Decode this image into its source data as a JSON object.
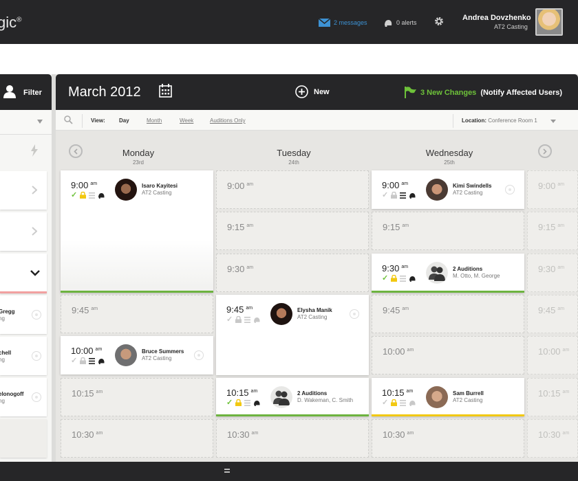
{
  "topbar": {
    "logo_text": "gic",
    "logo_mark": "®",
    "messages_label": "2 messages",
    "alerts_label": "0 alerts",
    "user_name": "Andrea Dovzhenko",
    "user_company": "AT2 Casting",
    "icons": [
      "mail-icon",
      "bell-icon",
      "gear-icon"
    ]
  },
  "left_panel": {
    "filter_label": "Filter",
    "cards": [
      {
        "name": "Gregg",
        "sub": "ng"
      },
      {
        "name": "chell",
        "sub": "ng"
      },
      {
        "name": "elonogoff",
        "sub": "ng"
      }
    ]
  },
  "calendar": {
    "month_label": "March 2012",
    "new_label": "New",
    "changes_count": "3 New Changes",
    "changes_action": "(Notify Affected Users)",
    "view_label": "View:",
    "view_options": [
      "Day",
      "Month",
      "Week",
      "Auditions Only"
    ],
    "active_view": "Day",
    "location_label": "Location:",
    "location_value": "Conference Room 1",
    "days": [
      {
        "name": "Monday",
        "date": "23rd"
      },
      {
        "name": "Tuesday",
        "date": "24th"
      },
      {
        "name": "Wednesday",
        "date": "25th"
      }
    ],
    "am": "am",
    "times": [
      "9:00",
      "9:15",
      "9:30",
      "9:45",
      "10:00",
      "10:15",
      "10:30"
    ],
    "appointments": {
      "mon_900": {
        "time": "9:00",
        "name": "Isaro Kayitesi",
        "sub": "AT2 Casting",
        "underline": "#6db33f"
      },
      "mon_1000": {
        "time": "10:00",
        "name": "Bruce Summers",
        "sub": "AT2 Casting"
      },
      "tue_945": {
        "time": "9:45",
        "name": "Elysha Manik",
        "sub": "AT2 Casting"
      },
      "tue_1015": {
        "time": "10:15",
        "name": "2 Auditions",
        "sub": "D. Wakeman, C. Smith",
        "underline": "#6db33f"
      },
      "wed_900": {
        "time": "9:00",
        "name": "Kimi Swindells",
        "sub": "AT2 Casting"
      },
      "wed_930": {
        "time": "9:30",
        "name": "2 Auditions",
        "sub": "M. Otto, M. George",
        "underline": "#6db33f"
      },
      "wed_1015": {
        "time": "10:15",
        "name": "Sam Burrell",
        "sub": "AT2 Casting",
        "underline": "#f2c811"
      }
    }
  },
  "colors": {
    "accent_green": "#6ec23a",
    "link_blue": "#3d92d4",
    "underline_yellow": "#f2c811",
    "dark_bar": "#262628"
  }
}
